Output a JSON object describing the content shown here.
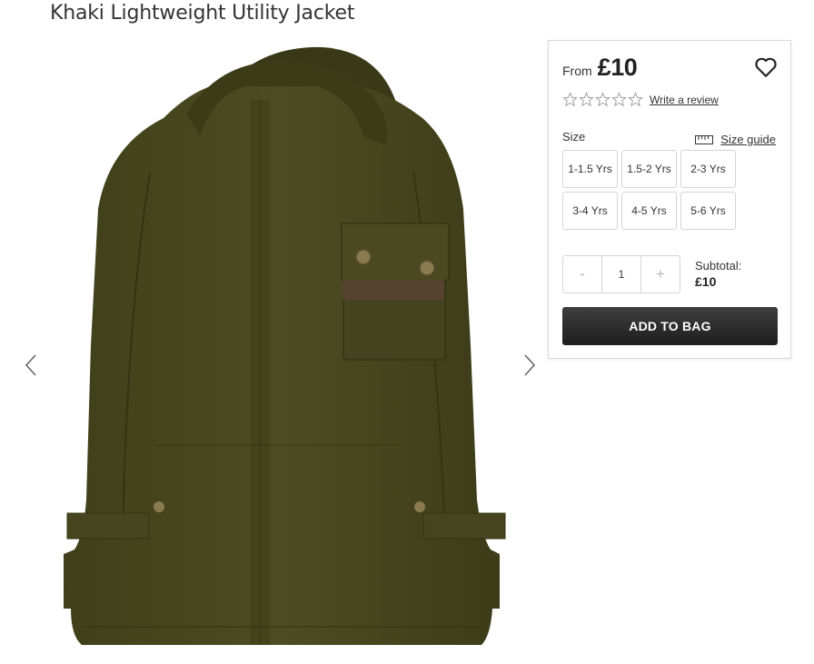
{
  "product": {
    "title": "Khaki Lightweight Utility Jacket",
    "price_prefix": "From",
    "price": "£10",
    "jacket_color": "#4b4a20"
  },
  "gallery": {
    "prev_icon": "chevron-left-icon",
    "next_icon": "chevron-right-icon"
  },
  "rating": {
    "stars": 0,
    "max_stars": 5,
    "review_link": "Write a review"
  },
  "size": {
    "label": "Size",
    "guide_link": "Size guide",
    "options": [
      "1-1.5 Yrs",
      "1.5-2 Yrs",
      "2-3 Yrs",
      "3-4 Yrs",
      "4-5 Yrs",
      "5-6 Yrs"
    ]
  },
  "quantity": {
    "decrement": "-",
    "value": "1",
    "increment": "+"
  },
  "subtotal": {
    "label": "Subtotal:",
    "value": "£10"
  },
  "cart": {
    "add_label": "ADD TO BAG",
    "button_color": "#2a2a2a"
  }
}
